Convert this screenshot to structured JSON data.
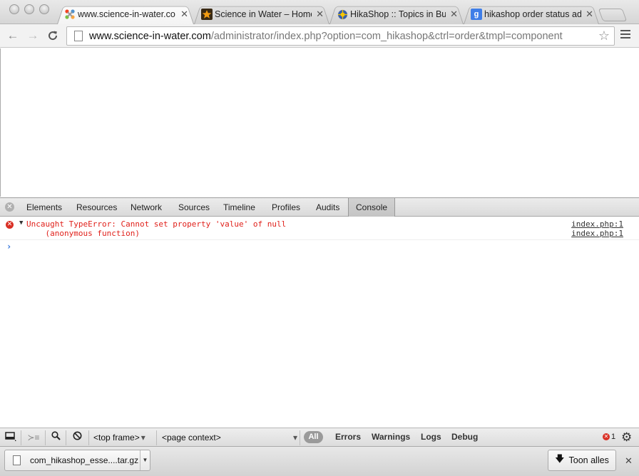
{
  "browser": {
    "tabs": [
      {
        "title": "www.science-in-water.co",
        "favicon": "joomla-icon",
        "active": true
      },
      {
        "title": "Science in Water – Home",
        "favicon": "star-favicon-icon",
        "active": false
      },
      {
        "title": "HikaShop :: Topics in Bug",
        "favicon": "hikashop-icon",
        "active": false
      },
      {
        "title": "hikashop order status adr",
        "favicon": "google-icon",
        "active": false
      }
    ],
    "tab_close_glyph": "✕",
    "url": {
      "host": "www.science-in-water.com",
      "path": "/administrator/index.php?option=com_hikashop&ctrl=order&tmpl=component"
    }
  },
  "devtools": {
    "close_glyph": "✕",
    "panels": [
      "Elements",
      "Resources",
      "Network",
      "Sources",
      "Timeline",
      "Profiles",
      "Audits",
      "Console"
    ],
    "active_panel": "Console",
    "console": {
      "error_line1": "Uncaught TypeError: Cannot set property 'value' of null",
      "error_line2": "    (anonymous function)",
      "source1": "index.php:1",
      "source2": "index.php:1",
      "prompt_glyph": "›"
    },
    "status_bar": {
      "frame_select": "<top frame>",
      "context_select": "<page context>",
      "filters": [
        "All",
        "Errors",
        "Warnings",
        "Logs",
        "Debug"
      ],
      "error_count": "1"
    }
  },
  "download_bar": {
    "file_name": "com_hikashop_esse....tar.gz",
    "show_all_label": "Toon alles"
  },
  "colors": {
    "error_red": "#e0201a",
    "prompt_blue": "#2a6ed8"
  }
}
